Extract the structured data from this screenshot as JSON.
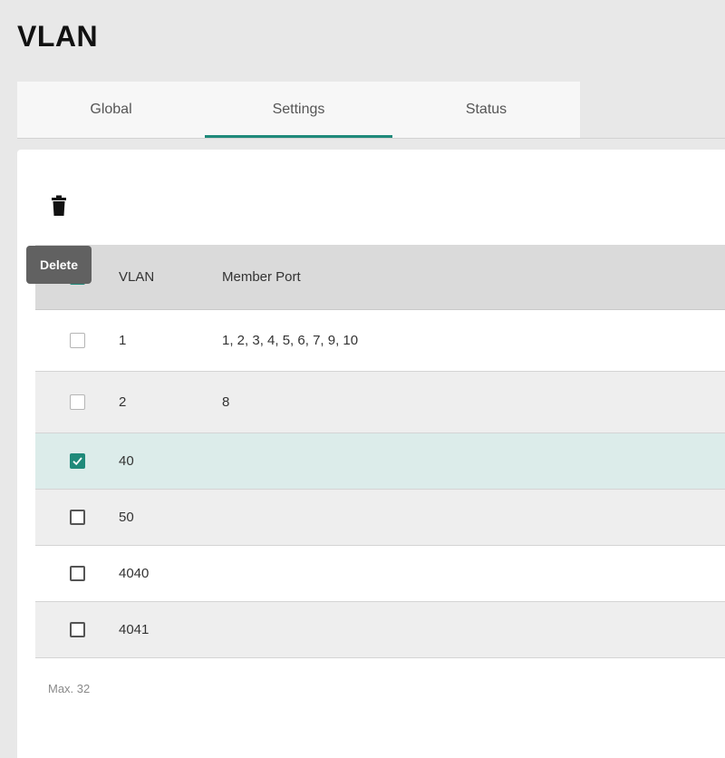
{
  "page": {
    "title": "VLAN"
  },
  "tabs": [
    {
      "label": "Global",
      "active": false
    },
    {
      "label": "Settings",
      "active": true
    },
    {
      "label": "Status",
      "active": false
    }
  ],
  "toolbar": {
    "delete_icon": "trash-icon",
    "delete_tooltip": "Delete"
  },
  "table": {
    "headers": {
      "vlan": "VLAN",
      "member_port": "Member Port"
    },
    "rows": [
      {
        "vlan": "1",
        "member_port": "1, 2, 3, 4, 5, 6, 7, 9, 10",
        "checked": false,
        "disabled": true
      },
      {
        "vlan": "2",
        "member_port": "8",
        "checked": false,
        "disabled": true
      },
      {
        "vlan": "40",
        "member_port": "",
        "checked": true,
        "disabled": false
      },
      {
        "vlan": "50",
        "member_port": "",
        "checked": false,
        "disabled": false
      },
      {
        "vlan": "4040",
        "member_port": "",
        "checked": false,
        "disabled": false
      },
      {
        "vlan": "4041",
        "member_port": "",
        "checked": false,
        "disabled": false
      }
    ]
  },
  "footer": {
    "note": "Max. 32"
  },
  "colors": {
    "accent": "#1f8a7a",
    "selected_row": "#dcecea",
    "header_bg": "#dadada",
    "tooltip_bg": "#616161"
  }
}
